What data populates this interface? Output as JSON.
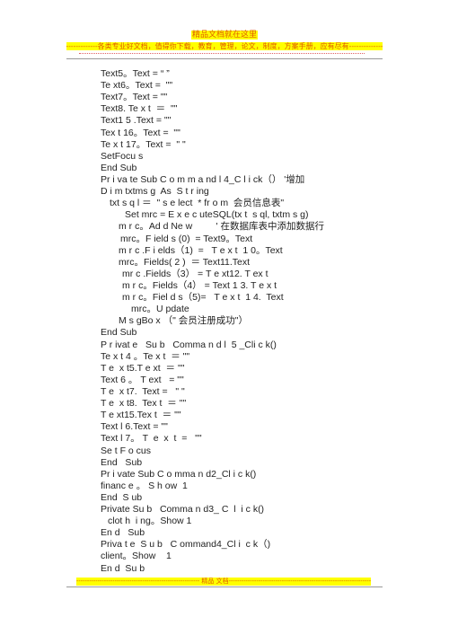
{
  "header": {
    "title": "精品文档就在这里",
    "subtitle": "-------------各类专业好文档，值得你下载，教育，管理，论文，制度，方案手册，应有尽有--------------"
  },
  "lines": [
    "Text5。Text = “ ”",
    "Te xt6。Text =  \"\"",
    "Text7。Text = \"\"",
    "Text8. Te x t  ＝  \"\"",
    "Text1 5 .Text = \"\"",
    "Tex t 16。Text =  \"\"",
    "Te x t 17。Text =  \" \"",
    "SetFocu s",
    "End Sub",
    "Pr i va te Sub C o m m a nd l 4_C l i ck（） '增加",
    "D i m txtms g  As  S t r ing",
    "txt s q l ＝  \" s e lect  * fr o m  会员信息表\"",
    "Set mrc = E x e c uteSQL(tx t  s ql, txtm s g)",
    "m r c。Ad d Ne w         ' 在数据库表中添加数据行",
    "mrc。F ield s (0)  = Text9。Text",
    "m r c .F i elds（1)  =   T e x t  1 0。Text",
    "mrc。Fields( 2 )  ＝ Text11.Text",
    "mr c .Fields（3） = T e xt12. T ex t",
    "m r c。Fields（4） = Text 1 3. T e x t",
    "m r c。Fiel d s（5)=   T e x t  1 4.  Text",
    "mrc。U pdate",
    "M s gBo x （\" 会员注册成功\"）",
    "End Sub",
    "P r ivat e   Su b   Comma n d l  5 _Cli c k()",
    "Te x t 4 。Te x t  ＝ \"\"",
    "T e  x t5.T e xt  ＝ \"\"",
    "Text 6 。 T ext   = \"\"",
    "T e  x t7.  Text =   \" \"",
    "T e  x t8.  Tex t  ＝ \"\"",
    "T e xt15.Tex t  ＝ \"\"",
    "Text l 6.Text = \"\"",
    "Text l 7。 T  e  x  t  =   \"\"",
    "Se t F o cus",
    "End   Sub",
    "Pr i vate Sub C o mma n d2_Cl i c k()",
    "financ e 。 S h ow  1",
    "End  S ub",
    "Private Su b   Comma n d3_ C  l  i c k()",
    "clot h  i ng。Show 1",
    "En d   Sub",
    "Priva t e  S u b   C ommand4_Cl i  c k（)",
    "client。Show    1",
    "En d  Su b"
  ],
  "footer": {
    "text": "---------------------------------------------------------- 精品   文档-------------------------------------------------------------------"
  }
}
